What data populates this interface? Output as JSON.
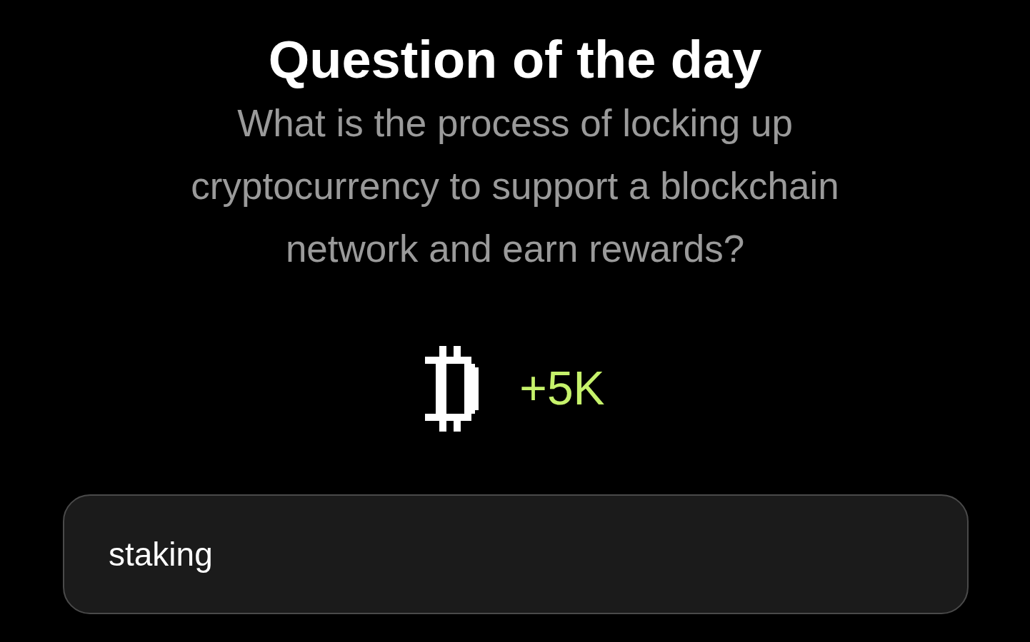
{
  "title": "Question of the day",
  "question": "What is the process of locking up cryptocurrency to support a blockchain network and earn rewards?",
  "reward": "+5K",
  "answer": {
    "value": "staking"
  }
}
